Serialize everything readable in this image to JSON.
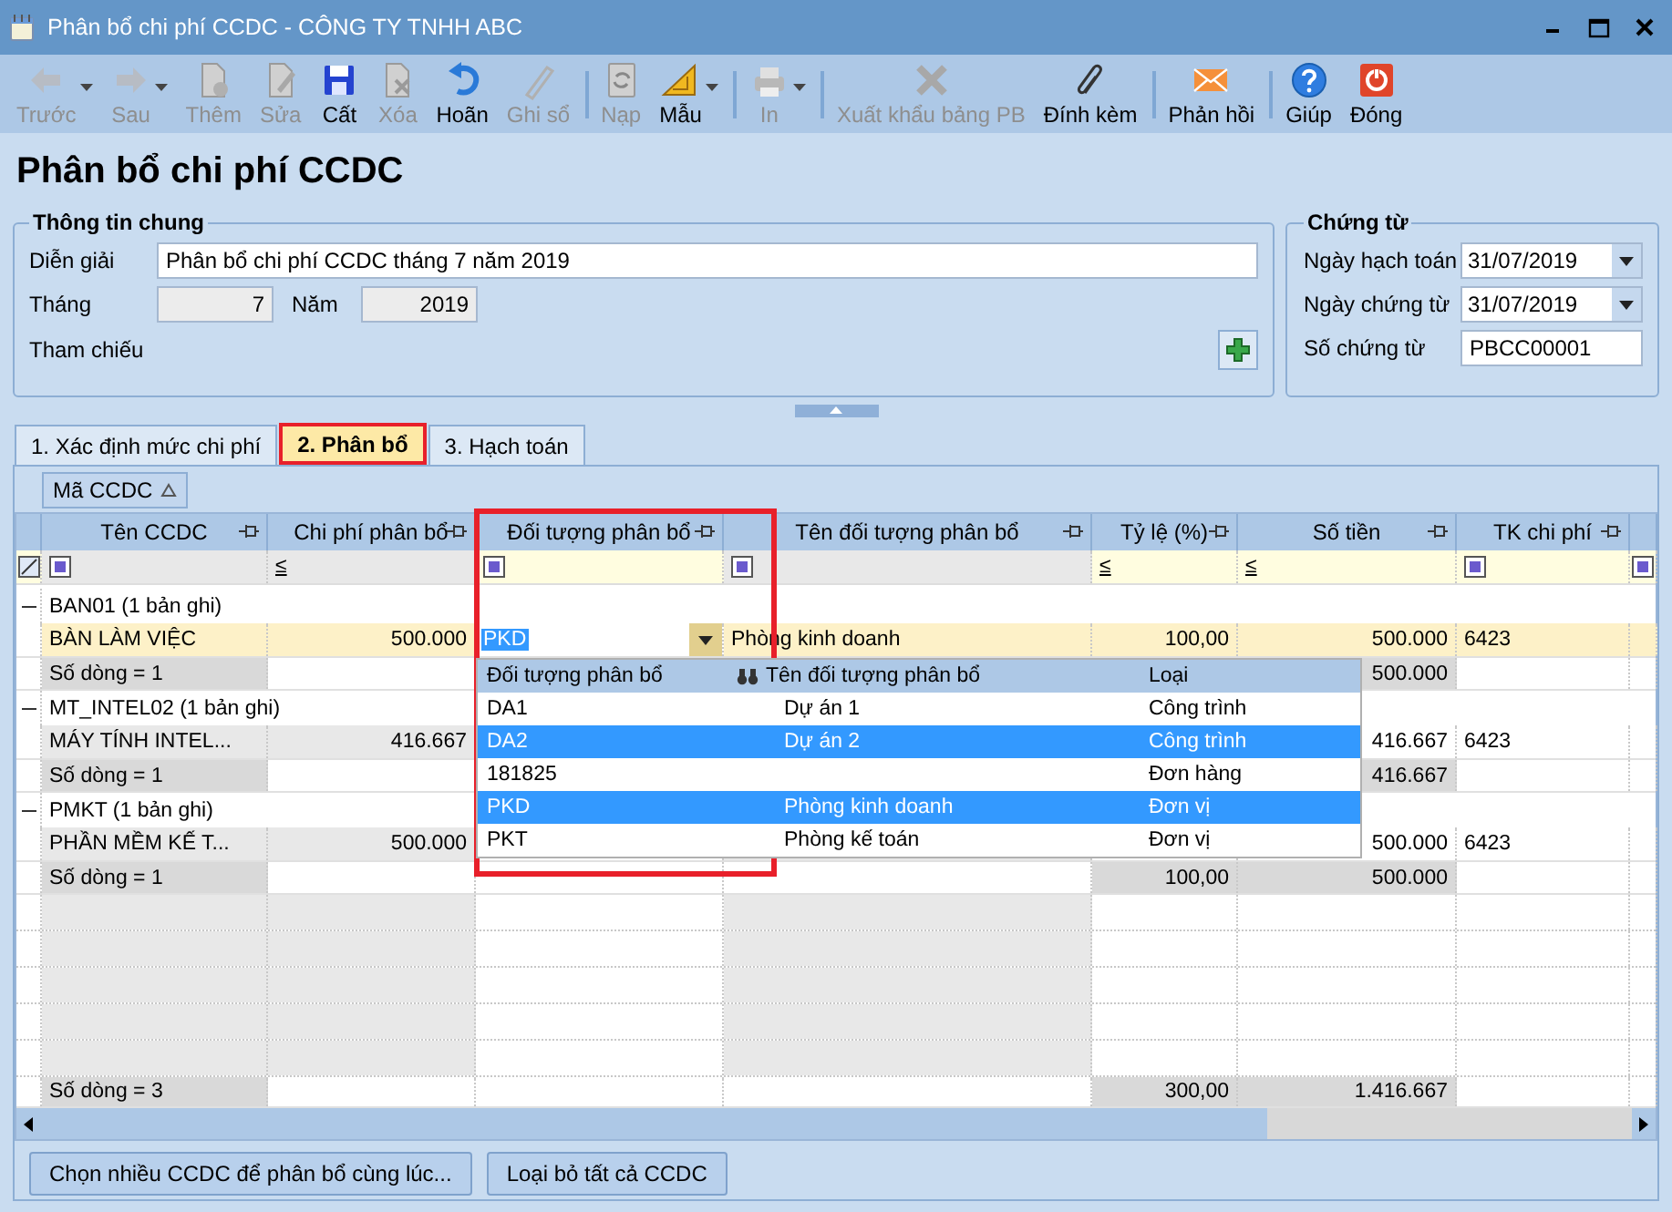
{
  "window": {
    "title": "Phân bổ chi phí CCDC - CÔNG TY TNHH ABC"
  },
  "toolbar": [
    {
      "kind": "back",
      "label": "Trước",
      "disabled": true,
      "dropdown": true,
      "separator": false
    },
    {
      "kind": "forward",
      "label": "Sau",
      "disabled": true,
      "dropdown": true,
      "separator": false
    },
    {
      "kind": "add",
      "label": "Thêm",
      "disabled": true,
      "dropdown": false,
      "separator": false
    },
    {
      "kind": "edit",
      "label": "Sửa",
      "disabled": true,
      "dropdown": false,
      "separator": false
    },
    {
      "kind": "save",
      "label": "Cất",
      "disabled": false,
      "dropdown": false,
      "separator": false
    },
    {
      "kind": "delete",
      "label": "Xóa",
      "disabled": true,
      "dropdown": false,
      "separator": false
    },
    {
      "kind": "undo",
      "label": "Hoãn",
      "disabled": false,
      "dropdown": false,
      "separator": false
    },
    {
      "kind": "post",
      "label": "Ghi sổ",
      "disabled": true,
      "dropdown": false,
      "separator": true
    },
    {
      "kind": "reload",
      "label": "Nạp",
      "disabled": true,
      "dropdown": false,
      "separator": false
    },
    {
      "kind": "template",
      "label": "Mẫu",
      "disabled": false,
      "dropdown": true,
      "separator": true
    },
    {
      "kind": "print",
      "label": "In",
      "disabled": true,
      "dropdown": true,
      "separator": true
    },
    {
      "kind": "export",
      "label": "Xuất khẩu bảng PB",
      "disabled": true,
      "dropdown": false,
      "separator": false
    },
    {
      "kind": "attach",
      "label": "Đính kèm",
      "disabled": false,
      "dropdown": false,
      "separator": true
    },
    {
      "kind": "feedback",
      "label": "Phản hồi",
      "disabled": false,
      "dropdown": false,
      "separator": true
    },
    {
      "kind": "help",
      "label": "Giúp",
      "disabled": false,
      "dropdown": false,
      "separator": false
    },
    {
      "kind": "close",
      "label": "Đóng",
      "disabled": false,
      "dropdown": false,
      "separator": false
    }
  ],
  "heading": "Phân bổ chi phí CCDC",
  "general": {
    "title": "Thông tin chung",
    "description": {
      "label": "Diễn giải",
      "value": "Phân bổ chi phí CCDC tháng 7 năm 2019"
    },
    "month": {
      "label": "Tháng",
      "value": "7"
    },
    "year": {
      "label": "Năm",
      "value": "2019"
    },
    "reference": {
      "label": "Tham chiếu"
    }
  },
  "voucher": {
    "title": "Chứng từ",
    "fields": [
      {
        "kind": "date",
        "label": "Ngày hạch toán",
        "value": "31/07/2019"
      },
      {
        "kind": "date",
        "label": "Ngày chứng từ",
        "value": "31/07/2019"
      },
      {
        "kind": "text",
        "label": "Số chứng từ",
        "value": "PBCC00001"
      }
    ]
  },
  "tabs": [
    {
      "label": "1. Xác định mức chi phí",
      "selected": false,
      "highlighted": false
    },
    {
      "label": "2. Phân bổ",
      "selected": true,
      "highlighted": true
    },
    {
      "label": "3. Hạch toán",
      "selected": false,
      "highlighted": false
    }
  ],
  "grid": {
    "group_by": "Mã CCDC",
    "columns": [
      {
        "label": "Tên CCDC",
        "numeric": false,
        "readonly": true,
        "highlighted": false,
        "filter": {
          "kind": "box"
        }
      },
      {
        "label": "Chi phí phân bổ",
        "numeric": true,
        "readonly": true,
        "highlighted": false,
        "filter": {
          "kind": "le",
          "symbol": "≤"
        }
      },
      {
        "label": "Đối tượng phân bổ",
        "numeric": false,
        "readonly": false,
        "highlighted": true,
        "filter": {
          "kind": "box"
        }
      },
      {
        "label": "Tên đối tượng phân bổ",
        "numeric": false,
        "readonly": true,
        "highlighted": false,
        "filter": {
          "kind": "box"
        }
      },
      {
        "label": "Tỷ lệ (%)",
        "numeric": true,
        "readonly": false,
        "highlighted": false,
        "filter": {
          "kind": "le",
          "symbol": "≤"
        }
      },
      {
        "label": "Số tiền",
        "numeric": true,
        "readonly": false,
        "highlighted": false,
        "filter": {
          "kind": "le",
          "symbol": "≤"
        }
      },
      {
        "label": "TK chi phí",
        "numeric": false,
        "readonly": false,
        "highlighted": false,
        "filter": {
          "kind": "box"
        }
      },
      {
        "numeric": false,
        "readonly": false,
        "highlighted": false,
        "filter": {
          "kind": "box"
        }
      }
    ],
    "groups": [
      {
        "label": "BAN01 (1 bản ghi)",
        "expanded": true,
        "rows": [
          {
            "selected": true,
            "cells": {
              "ten_ccdc": "BÀN LÀM VIỆC",
              "chi_phi_phan_bo": "500.000",
              "doi_tuong_phan_bo": {
                "text": "PKD",
                "editing": true
              },
              "ten_doi_tuong_phan_bo": "Phòng kinh doanh",
              "ty_le": "100,00",
              "so_tien": "500.000",
              "tk_chi_phi": "6423"
            }
          }
        ],
        "summary": {
          "ten_ccdc": "Số dòng = 1",
          "so_tien": "500.000"
        }
      },
      {
        "label": "MT_INTEL02 (1 bản ghi)",
        "expanded": true,
        "rows": [
          {
            "selected": false,
            "cells": {
              "ten_ccdc": "MÁY TÍNH INTEL...",
              "chi_phi_phan_bo": "416.667",
              "so_tien": "416.667",
              "tk_chi_phi": "6423"
            }
          }
        ],
        "summary": {
          "ten_ccdc": "Số dòng = 1",
          "so_tien": "416.667"
        }
      },
      {
        "label": "PMKT (1 bản ghi)",
        "expanded": true,
        "rows": [
          {
            "selected": false,
            "cells": {
              "ten_ccdc": "PHẦN MỀM KẾ T...",
              "chi_phi_phan_bo": "500.000",
              "so_tien": "500.000",
              "tk_chi_phi": "6423"
            }
          }
        ],
        "summary": {
          "ten_ccdc": "Số dòng = 1",
          "ty_le": "100,00",
          "so_tien": "500.000"
        }
      }
    ],
    "footer": {
      "ten_ccdc": "Số dòng = 3",
      "ty_le": "300,00",
      "so_tien": "1.416.667"
    },
    "dropdown": {
      "columns": [
        "Đối tượng phân bổ",
        "Tên đối tượng phân bổ",
        "Loại"
      ],
      "items": [
        {
          "code": "DA1",
          "name": "Dự án 1",
          "type": "Công trình",
          "selected": false
        },
        {
          "code": "DA2",
          "name": "Dự án 2",
          "type": "Công trình",
          "selected": true
        },
        {
          "code": "181825",
          "type": "Đơn hàng",
          "selected": false
        },
        {
          "code": "PKD",
          "name": "Phòng kinh doanh",
          "type": "Đơn vị",
          "selected": true
        },
        {
          "code": "PKT",
          "name": "Phòng kế toán",
          "type": "Đơn vị",
          "selected": false
        }
      ]
    }
  },
  "buttons": [
    "Chọn nhiều CCDC để phân bổ cùng lúc...",
    "Loại bỏ tất cả CCDC"
  ]
}
